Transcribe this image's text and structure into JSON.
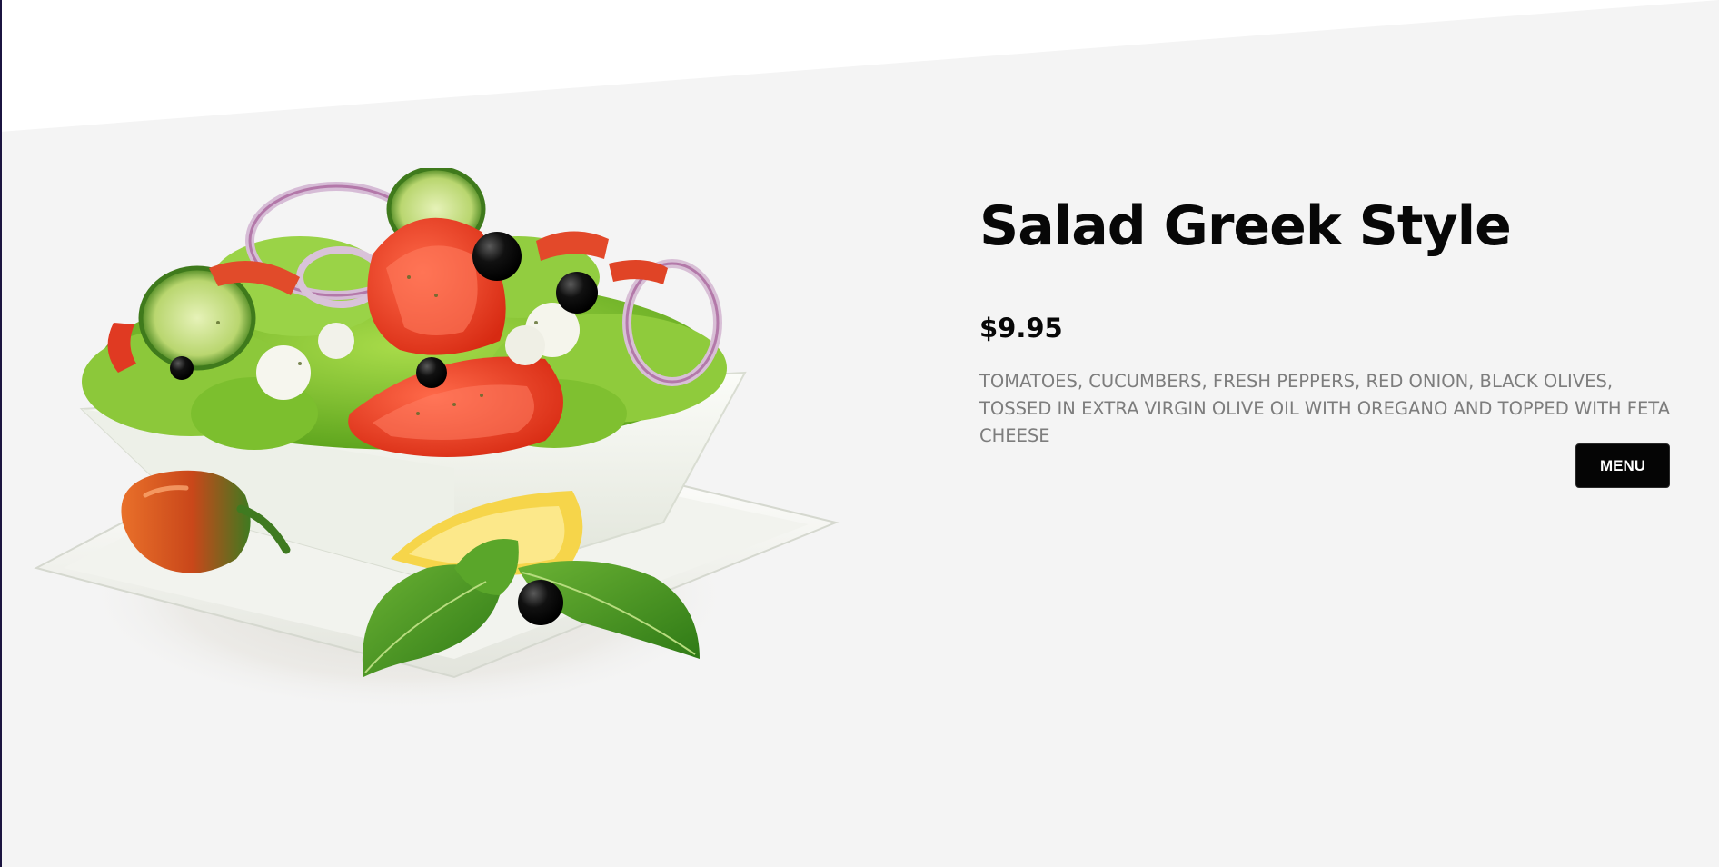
{
  "product": {
    "title": "Salad Greek Style",
    "price": "$9.95",
    "description": "TOMATOES, CUCUMBERS, FRESH PEPPERS, RED ONION, BLACK OLIVES, TOSSED IN EXTRA VIRGIN OLIVE OIL WITH OREGANO AND TOPPED WITH FETA CHEESE",
    "image_alt": "Greek salad in a white bowl on a plate with a pepper, lemon and basil"
  },
  "actions": {
    "menu_label": "MENU"
  },
  "colors": {
    "page_background": "#ffffff",
    "section_background": "#f4f4f4",
    "title": "#070707",
    "description": "#7d7d7d",
    "button_background": "#050505",
    "button_text": "#ffffff"
  }
}
